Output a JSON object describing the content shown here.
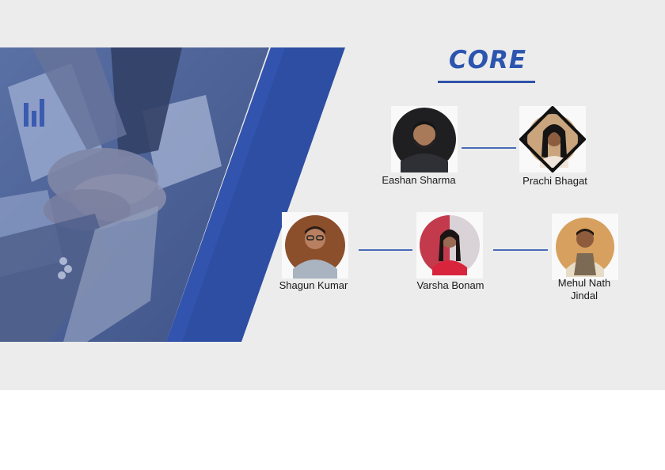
{
  "slide": {
    "title": "CORE"
  },
  "members": [
    {
      "name": "Eashan Sharma"
    },
    {
      "name": "Prachi Bhagat"
    },
    {
      "name": "Shagun Kumar"
    },
    {
      "name": "Varsha Bonam"
    },
    {
      "name_line1": "Mehul Nath",
      "name_line2": "Jindal"
    }
  ],
  "colors": {
    "accent_blue": "#2c55b0",
    "connector_blue": "#4a6bb8",
    "background": "#ececec"
  },
  "icons": [
    "person-photo",
    "team-hands-photo"
  ]
}
